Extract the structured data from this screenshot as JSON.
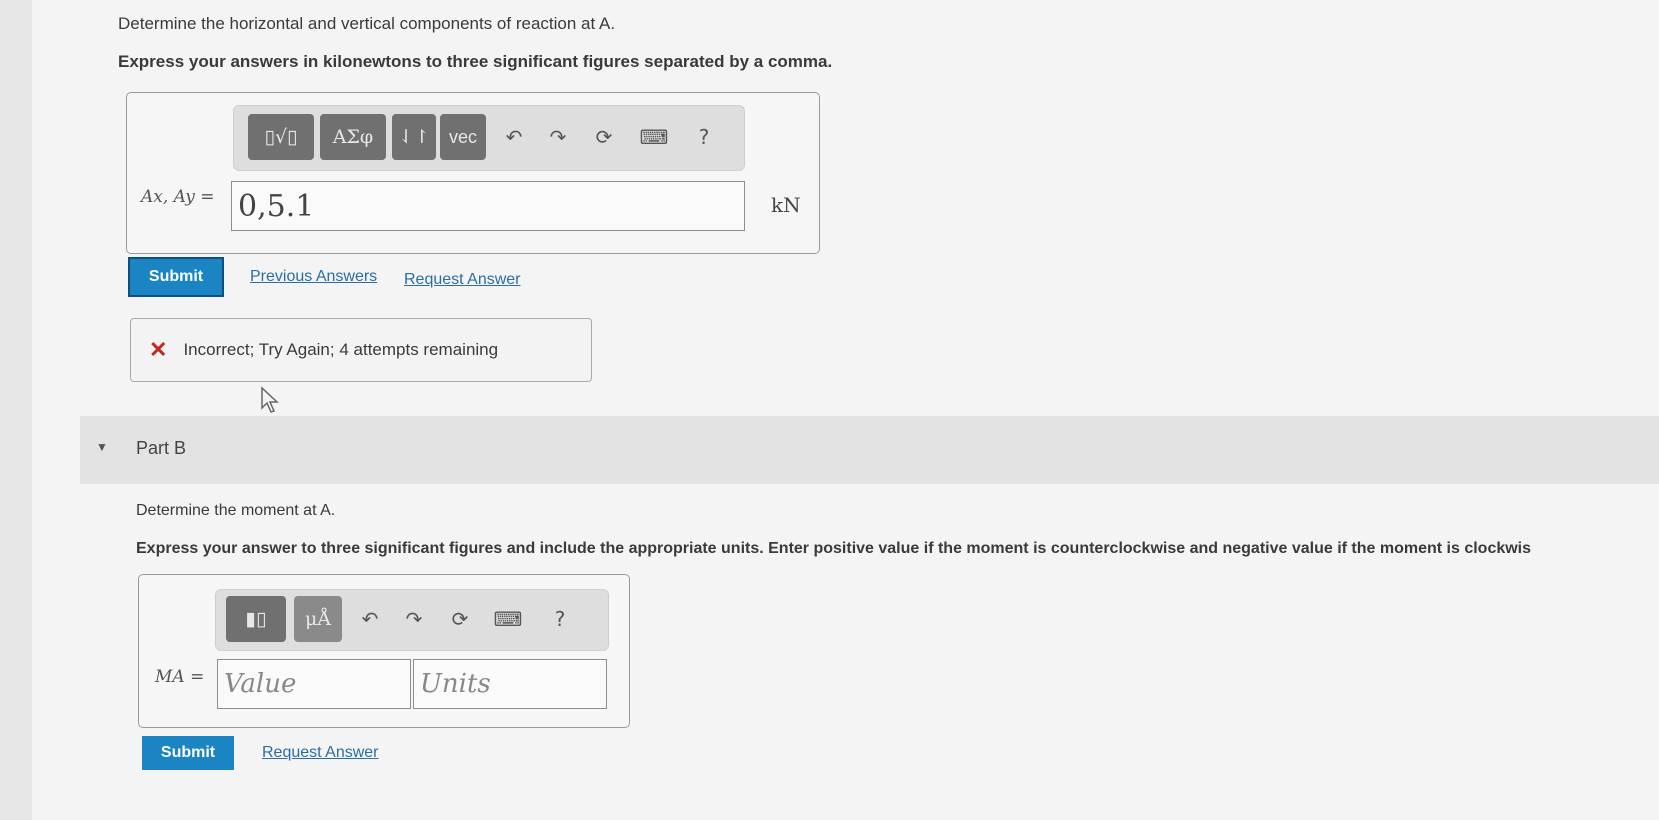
{
  "part_a": {
    "question": "Determine the horizontal and vertical components of reaction at A.",
    "instruction": "Express your answers in kilonewtons to three significant figures separated by a comma.",
    "toolbar": {
      "templates_label": "▯√▯",
      "greek_label": "ΑΣφ",
      "sort_label": "⇃↾",
      "vec_label": "vec",
      "undo_icon": "↶",
      "redo_icon": "↷",
      "reset_icon": "⟳",
      "keyboard_icon": "⌨",
      "help_label": "?"
    },
    "input_label": "Ax, Ay =",
    "input_value": "0,5.1",
    "unit": "kN",
    "submit_label": "Submit",
    "previous_answers_label": "Previous Answers",
    "request_answer_label": "Request Answer",
    "feedback_icon": "✕",
    "feedback_text": "Incorrect; Try Again; 4 attempts remaining"
  },
  "part_b": {
    "title": "Part B",
    "question": "Determine the moment at A.",
    "instruction": "Express your answer to three significant figures and include the appropriate units. Enter positive value if the moment is counterclockwise and negative value if the moment is clockwis",
    "toolbar": {
      "templates_label": "▮▯",
      "units_label": "μÅ",
      "undo_icon": "↶",
      "redo_icon": "↷",
      "reset_icon": "⟳",
      "keyboard_icon": "⌨",
      "help_label": "?"
    },
    "input_label": "MA =",
    "value_placeholder": "Value",
    "units_placeholder": "Units",
    "submit_label": "Submit",
    "request_answer_label": "Request Answer"
  },
  "colors": {
    "submit_blue": "#1b84c2",
    "error_red": "#c0281c",
    "link_blue": "#2a6ea6"
  }
}
